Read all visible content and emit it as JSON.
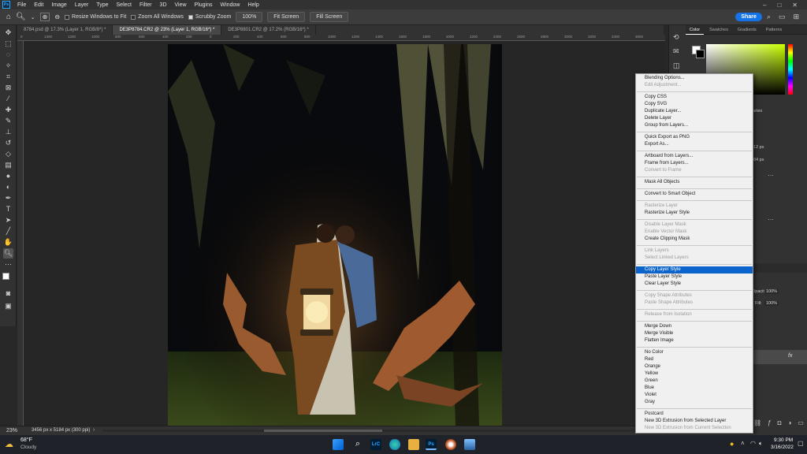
{
  "menubar": {
    "logo": "Ps",
    "items": [
      "File",
      "Edit",
      "Image",
      "Layer",
      "Type",
      "Select",
      "Filter",
      "3D",
      "View",
      "Plugins",
      "Window",
      "Help"
    ],
    "controls": [
      "–",
      "□",
      "✕"
    ]
  },
  "options": {
    "resize_windows": "Resize Windows to Fit",
    "zoom_all": "Zoom All Windows",
    "scrubby_zoom": "Scrubby Zoom",
    "zoom_100": "100%",
    "fit_screen": "Fit Screen",
    "fill_screen": "Fill Screen",
    "share": "Share"
  },
  "tabs": [
    {
      "label": "8784.psd @ 17.3% (Layer 1, RGB/8*) *",
      "active": false
    },
    {
      "label": "DE3P8784.CR2 @ 23% (Layer 1, RGB/16*) *",
      "active": true
    },
    {
      "label": "DE3P8801.CR2 @ 17.2% (RGB/16*) *",
      "active": false
    }
  ],
  "ruler_top": [
    "0",
    "1400",
    "1200",
    "1000",
    "800",
    "600",
    "400",
    "200",
    "0",
    "200",
    "400",
    "600",
    "800",
    "1000",
    "1200",
    "1400",
    "1600",
    "1800",
    "2000",
    "2200",
    "2400",
    "2600",
    "2800",
    "3000",
    "3200",
    "3400",
    "3600"
  ],
  "status": {
    "zoom": "23%",
    "dims": "3456 px x 5184 px (300 ppi)"
  },
  "panels": {
    "tabs": [
      "Color",
      "Swatches",
      "Gradients",
      "Patterns"
    ],
    "libraries": "Libraries",
    "w": "12 px",
    "h": "84 px",
    "opacity_label": "Opacity:",
    "opacity": "100%",
    "fill_label": "Fill:",
    "fill": "100%",
    "fx": "fx"
  },
  "context_menu": [
    {
      "label": "Blending Options...",
      "disabled": false
    },
    {
      "label": "Edit Adjustment...",
      "disabled": true
    },
    {
      "sep": true
    },
    {
      "label": "Copy CSS",
      "disabled": false
    },
    {
      "label": "Copy SVG",
      "disabled": false
    },
    {
      "label": "Duplicate Layer...",
      "disabled": false
    },
    {
      "label": "Delete Layer",
      "disabled": false
    },
    {
      "label": "Group from Layers...",
      "disabled": false
    },
    {
      "sep": true
    },
    {
      "label": "Quick Export as PNG",
      "disabled": false
    },
    {
      "label": "Export As...",
      "disabled": false
    },
    {
      "sep": true
    },
    {
      "label": "Artboard from Layers...",
      "disabled": false
    },
    {
      "label": "Frame from Layers...",
      "disabled": false
    },
    {
      "label": "Convert to Frame",
      "disabled": true
    },
    {
      "sep": true
    },
    {
      "label": "Mask All Objects",
      "disabled": false
    },
    {
      "sep": true
    },
    {
      "label": "Convert to Smart Object",
      "disabled": false
    },
    {
      "sep": true
    },
    {
      "label": "Rasterize Layer",
      "disabled": true
    },
    {
      "label": "Rasterize Layer Style",
      "disabled": false
    },
    {
      "sep": true
    },
    {
      "label": "Disable Layer Mask",
      "disabled": true
    },
    {
      "label": "Enable Vector Mask",
      "disabled": true
    },
    {
      "label": "Create Clipping Mask",
      "disabled": false
    },
    {
      "sep": true
    },
    {
      "label": "Link Layers",
      "disabled": true
    },
    {
      "label": "Select Linked Layers",
      "disabled": true
    },
    {
      "sep": true
    },
    {
      "label": "Copy Layer Style",
      "disabled": false,
      "highlighted": true
    },
    {
      "label": "Paste Layer Style",
      "disabled": false
    },
    {
      "label": "Clear Layer Style",
      "disabled": false
    },
    {
      "sep": true
    },
    {
      "label": "Copy Shape Attributes",
      "disabled": true
    },
    {
      "label": "Paste Shape Attributes",
      "disabled": true
    },
    {
      "sep": true
    },
    {
      "label": "Release from Isolation",
      "disabled": true
    },
    {
      "sep": true
    },
    {
      "label": "Merge Down",
      "disabled": false
    },
    {
      "label": "Merge Visible",
      "disabled": false
    },
    {
      "label": "Flatten Image",
      "disabled": false
    },
    {
      "sep": true
    },
    {
      "label": "No Color",
      "disabled": false
    },
    {
      "label": "Red",
      "disabled": false
    },
    {
      "label": "Orange",
      "disabled": false
    },
    {
      "label": "Yellow",
      "disabled": false
    },
    {
      "label": "Green",
      "disabled": false
    },
    {
      "label": "Blue",
      "disabled": false
    },
    {
      "label": "Violet",
      "disabled": false
    },
    {
      "label": "Gray",
      "disabled": false
    },
    {
      "sep": true
    },
    {
      "label": "Postcard",
      "disabled": false
    },
    {
      "label": "New 3D Extrusion from Selected Layer",
      "disabled": false
    },
    {
      "label": "New 3D Extrusion from Current Selection",
      "disabled": true
    }
  ],
  "taskbar": {
    "temp": "68°F",
    "weather": "Cloudy",
    "time": "9:30 PM",
    "date": "3/16/2022",
    "lrc": "LrC",
    "ps": "Ps"
  },
  "colors": {
    "accent": "#0a64cc",
    "share": "#1473e6",
    "ps_blue": "#31a8ff"
  }
}
